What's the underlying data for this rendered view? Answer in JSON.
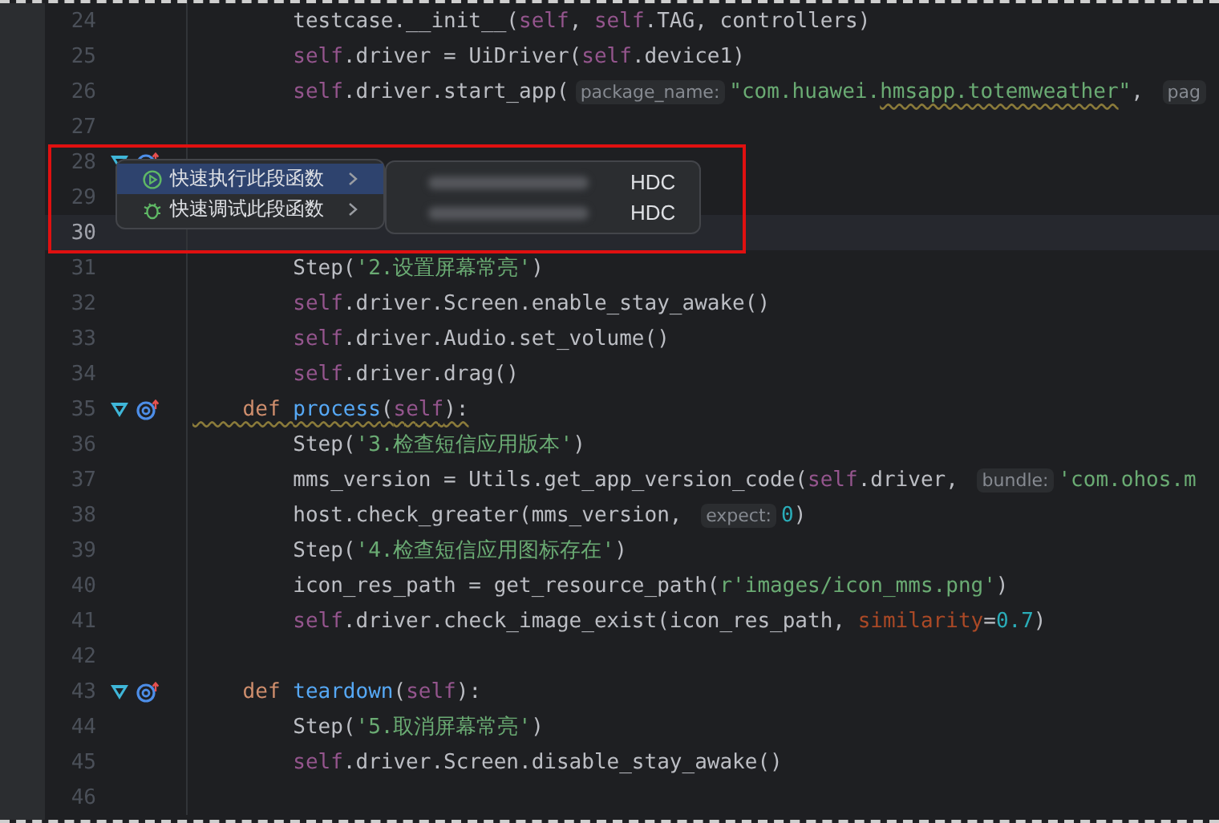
{
  "lines": [
    {
      "num": "24",
      "current": false,
      "marker": false,
      "tokens": [
        {
          "kind": "plain",
          "text": "        testcase.__init__("
        },
        {
          "kind": "self",
          "text": "self"
        },
        {
          "kind": "plain",
          "text": ", "
        },
        {
          "kind": "self",
          "text": "self"
        },
        {
          "kind": "plain",
          "text": ".TAG, controllers)"
        }
      ]
    },
    {
      "num": "25",
      "current": false,
      "marker": false,
      "tokens": [
        {
          "kind": "self",
          "text": "        self"
        },
        {
          "kind": "plain",
          "text": ".driver = UiDriver("
        },
        {
          "kind": "self",
          "text": "self"
        },
        {
          "kind": "plain",
          "text": ".device1)"
        }
      ]
    },
    {
      "num": "26",
      "current": false,
      "marker": false,
      "tokens": [
        {
          "kind": "self",
          "text": "        self"
        },
        {
          "kind": "plain",
          "text": ".driver.start_app("
        },
        {
          "kind": "hint",
          "text": "package_name:"
        },
        {
          "kind": "str",
          "text": "\"com.huawei."
        },
        {
          "kind": "str-typo",
          "text": "hmsapp.totemweather"
        },
        {
          "kind": "str",
          "text": "\""
        },
        {
          "kind": "plain",
          "text": ", "
        },
        {
          "kind": "hint",
          "text": "pag"
        }
      ]
    },
    {
      "num": "27",
      "current": false,
      "marker": false
    },
    {
      "num": "28",
      "current": false,
      "marker": true
    },
    {
      "num": "29",
      "current": false,
      "marker": false
    },
    {
      "num": "30",
      "current": true,
      "marker": false
    },
    {
      "num": "31",
      "current": false,
      "marker": false,
      "tokens": [
        {
          "kind": "plain",
          "text": "        Step("
        },
        {
          "kind": "str",
          "text": "'2.设置屏幕常亮'"
        },
        {
          "kind": "plain",
          "text": ")"
        }
      ]
    },
    {
      "num": "32",
      "current": false,
      "marker": false,
      "tokens": [
        {
          "kind": "self",
          "text": "        self"
        },
        {
          "kind": "plain",
          "text": ".driver.Screen.enable_stay_awake()"
        }
      ]
    },
    {
      "num": "33",
      "current": false,
      "marker": false,
      "tokens": [
        {
          "kind": "self",
          "text": "        self"
        },
        {
          "kind": "plain",
          "text": ".driver.Audio.set_volume()"
        }
      ]
    },
    {
      "num": "34",
      "current": false,
      "marker": false,
      "tokens": [
        {
          "kind": "self",
          "text": "        self"
        },
        {
          "kind": "plain",
          "text": ".driver.drag()"
        }
      ]
    },
    {
      "num": "35",
      "current": false,
      "marker": true,
      "tokens": [
        {
          "kind": "kw-typo",
          "text": "    def "
        },
        {
          "kind": "fn-typo",
          "text": "process"
        },
        {
          "kind": "plain-typo",
          "text": "("
        },
        {
          "kind": "self-typo",
          "text": "self"
        },
        {
          "kind": "plain-typo",
          "text": "):"
        }
      ]
    },
    {
      "num": "36",
      "current": false,
      "marker": false,
      "tokens": [
        {
          "kind": "plain",
          "text": "        Step("
        },
        {
          "kind": "str",
          "text": "'3.检查短信应用版本'"
        },
        {
          "kind": "plain",
          "text": ")"
        }
      ]
    },
    {
      "num": "37",
      "current": false,
      "marker": false,
      "tokens": [
        {
          "kind": "plain",
          "text": "        mms_version = Utils.get_app_version_code("
        },
        {
          "kind": "self",
          "text": "self"
        },
        {
          "kind": "plain",
          "text": ".driver, "
        },
        {
          "kind": "hint",
          "text": "bundle:"
        },
        {
          "kind": "str",
          "text": "'com.ohos.m"
        }
      ]
    },
    {
      "num": "38",
      "current": false,
      "marker": false,
      "tokens": [
        {
          "kind": "plain",
          "text": "        host.check_greater(mms_version, "
        },
        {
          "kind": "hint",
          "text": "expect:"
        },
        {
          "kind": "num",
          "text": "0"
        },
        {
          "kind": "plain",
          "text": ")"
        }
      ]
    },
    {
      "num": "39",
      "current": false,
      "marker": false,
      "tokens": [
        {
          "kind": "plain",
          "text": "        Step("
        },
        {
          "kind": "str",
          "text": "'4.检查短信应用图标存在'"
        },
        {
          "kind": "plain",
          "text": ")"
        }
      ]
    },
    {
      "num": "40",
      "current": false,
      "marker": false,
      "tokens": [
        {
          "kind": "plain",
          "text": "        icon_res_path = get_resource_path("
        },
        {
          "kind": "str",
          "text": "r'images/icon_mms.png'"
        },
        {
          "kind": "plain",
          "text": ")"
        }
      ]
    },
    {
      "num": "41",
      "current": false,
      "marker": false,
      "tokens": [
        {
          "kind": "self",
          "text": "        self"
        },
        {
          "kind": "plain",
          "text": ".driver.check_image_exist(icon_res_path, "
        },
        {
          "kind": "param",
          "text": "similarity"
        },
        {
          "kind": "plain",
          "text": "="
        },
        {
          "kind": "num",
          "text": "0.7"
        },
        {
          "kind": "plain",
          "text": ")"
        }
      ]
    },
    {
      "num": "42",
      "current": false,
      "marker": false
    },
    {
      "num": "43",
      "current": false,
      "marker": true,
      "tokens": [
        {
          "kind": "kw",
          "text": "    def "
        },
        {
          "kind": "fn",
          "text": "teardown"
        },
        {
          "kind": "plain",
          "text": "("
        },
        {
          "kind": "self",
          "text": "self"
        },
        {
          "kind": "plain",
          "text": "):"
        }
      ]
    },
    {
      "num": "44",
      "current": false,
      "marker": false,
      "tokens": [
        {
          "kind": "plain",
          "text": "        Step("
        },
        {
          "kind": "str",
          "text": "'5.取消屏幕常亮'"
        },
        {
          "kind": "plain",
          "text": ")"
        }
      ]
    },
    {
      "num": "45",
      "current": false,
      "marker": false,
      "tokens": [
        {
          "kind": "self",
          "text": "        self"
        },
        {
          "kind": "plain",
          "text": ".driver.Screen.disable_stay_awake()"
        }
      ]
    },
    {
      "num": "46",
      "current": false,
      "marker": false
    }
  ],
  "context_menu": {
    "items": [
      {
        "kind": "run",
        "label": "快速执行此段函数",
        "selected": true
      },
      {
        "kind": "debug",
        "label": "快速调试此段函数",
        "selected": false
      }
    ]
  },
  "submenu": {
    "items": [
      {
        "label": "HDC",
        "selected": false
      },
      {
        "label": "HDC",
        "selected": false
      }
    ]
  },
  "highlight_frame": true
}
